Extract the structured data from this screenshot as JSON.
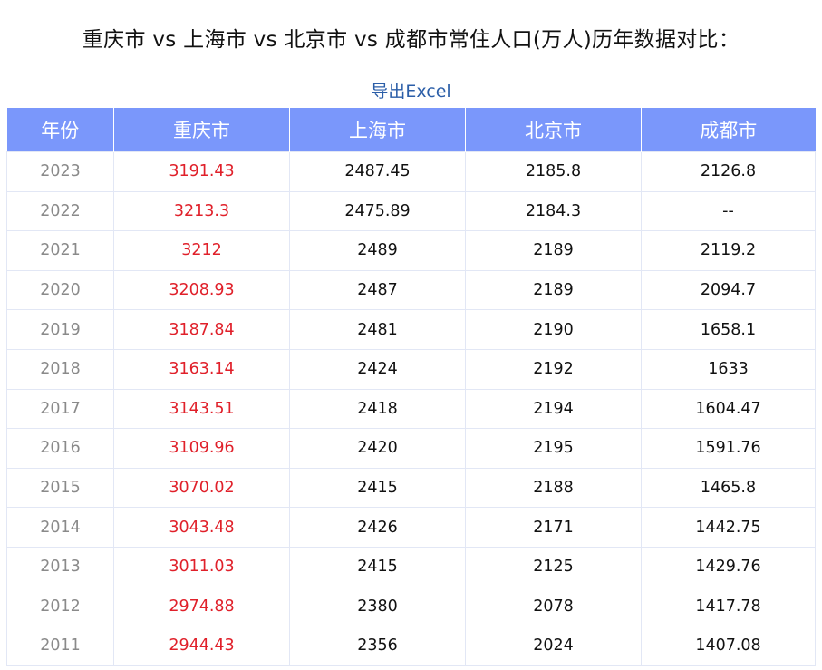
{
  "page": {
    "title": "重庆市 vs 上海市 vs 北京市 vs 成都市常住人口(万人)历年数据对比：",
    "export_label": "导出Excel"
  },
  "table": {
    "headers": [
      "年份",
      "重庆市",
      "上海市",
      "北京市",
      "成都市"
    ],
    "rows": [
      [
        "2023",
        "3191.43",
        "2487.45",
        "2185.8",
        "2126.8"
      ],
      [
        "2022",
        "3213.3",
        "2475.89",
        "2184.3",
        "--"
      ],
      [
        "2021",
        "3212",
        "2489",
        "2189",
        "2119.2"
      ],
      [
        "2020",
        "3208.93",
        "2487",
        "2189",
        "2094.7"
      ],
      [
        "2019",
        "3187.84",
        "2481",
        "2190",
        "1658.1"
      ],
      [
        "2018",
        "3163.14",
        "2424",
        "2192",
        "1633"
      ],
      [
        "2017",
        "3143.51",
        "2418",
        "2194",
        "1604.47"
      ],
      [
        "2016",
        "3109.96",
        "2420",
        "2195",
        "1591.76"
      ],
      [
        "2015",
        "3070.02",
        "2415",
        "2188",
        "1465.8"
      ],
      [
        "2014",
        "3043.48",
        "2426",
        "2171",
        "1442.75"
      ],
      [
        "2013",
        "3011.03",
        "2415",
        "2125",
        "1429.76"
      ],
      [
        "2012",
        "2974.88",
        "2380",
        "2078",
        "1417.78"
      ],
      [
        "2011",
        "2944.43",
        "2356",
        "2024",
        "1407.08"
      ]
    ]
  },
  "colors": {
    "header_bg": "#7a97fb",
    "highlight_text": "#e0202a",
    "link": "#2b5ea8"
  }
}
